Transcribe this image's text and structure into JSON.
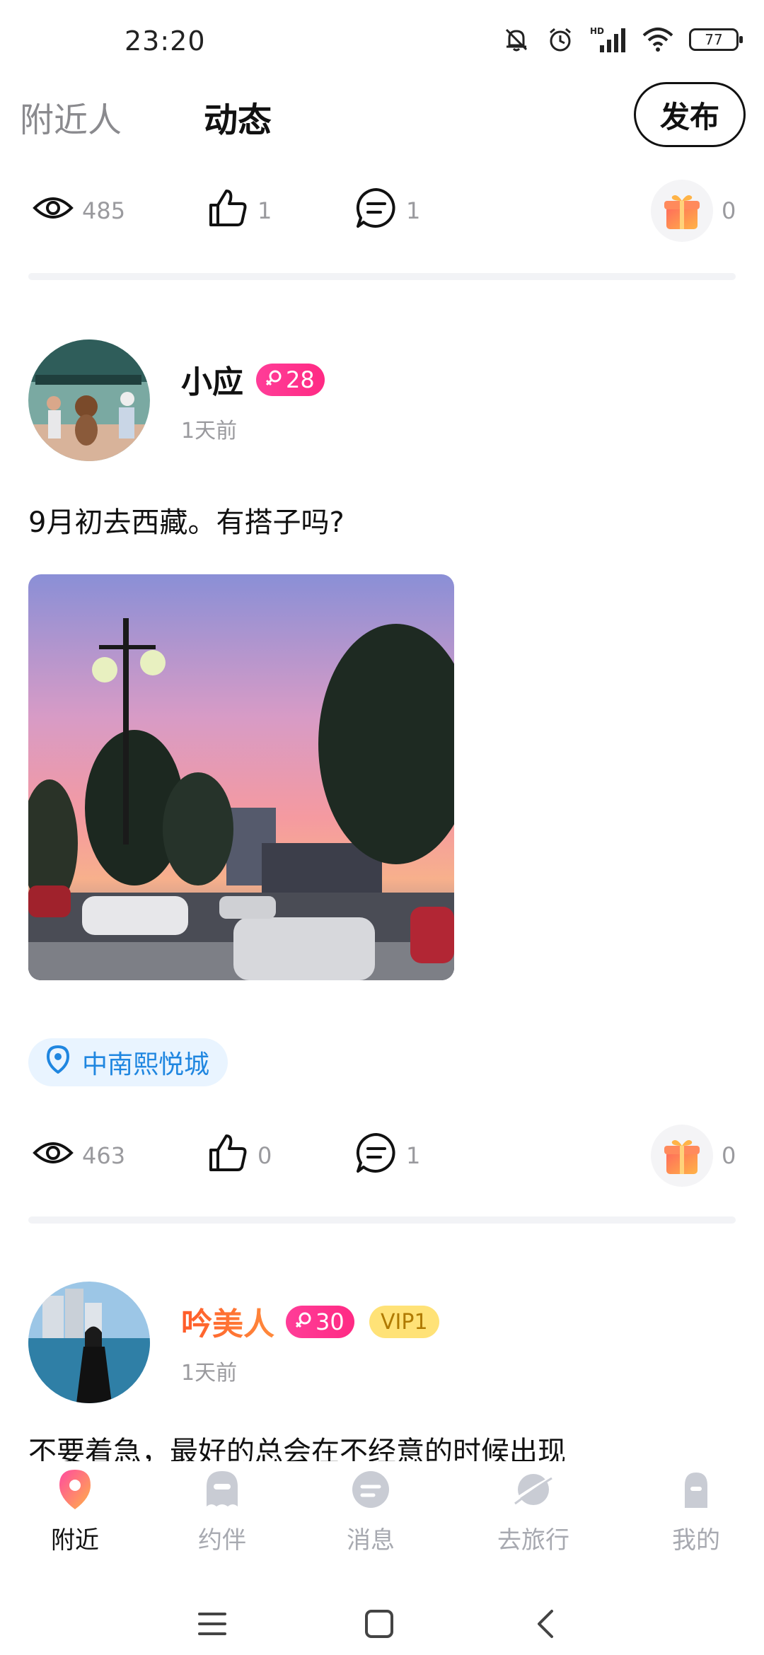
{
  "status": {
    "time": "23:20",
    "battery": "77",
    "network": "HD"
  },
  "header": {
    "tabs": [
      "附近人",
      "动态"
    ],
    "publish_label": "发布"
  },
  "prev_post": {
    "views": "485",
    "likes": "1",
    "comments": "1",
    "gifts": "0"
  },
  "posts": [
    {
      "username": "小应",
      "age": "28",
      "time_ago": "1天前",
      "text": "9月初去西藏。有搭子吗?",
      "location": "中南熙悦城",
      "views": "463",
      "likes": "0",
      "comments": "1",
      "gifts": "0"
    },
    {
      "username": "吟美人",
      "age": "30",
      "vip": "VIP1",
      "time_ago": "1天前",
      "text": "不要着急，最好的总会在不经意的时候出现"
    }
  ],
  "bottom_nav": [
    "附近",
    "约伴",
    "消息",
    "去旅行",
    "我的"
  ],
  "colors": {
    "accent_pink": "#ff2a84",
    "location_blue": "#1f86e0",
    "vip_yellow": "#ffe277",
    "username_gradient": [
      "#ff5b2a",
      "#ff8a3c"
    ]
  },
  "icons": [
    "muted-bell-icon",
    "alarm-icon",
    "signal-icon",
    "wifi-icon",
    "battery-icon",
    "eye-icon",
    "thumb-up-icon",
    "comment-icon",
    "gift-icon",
    "location-pin-icon",
    "female-icon",
    "menu-icon",
    "home-square-icon",
    "back-icon"
  ]
}
